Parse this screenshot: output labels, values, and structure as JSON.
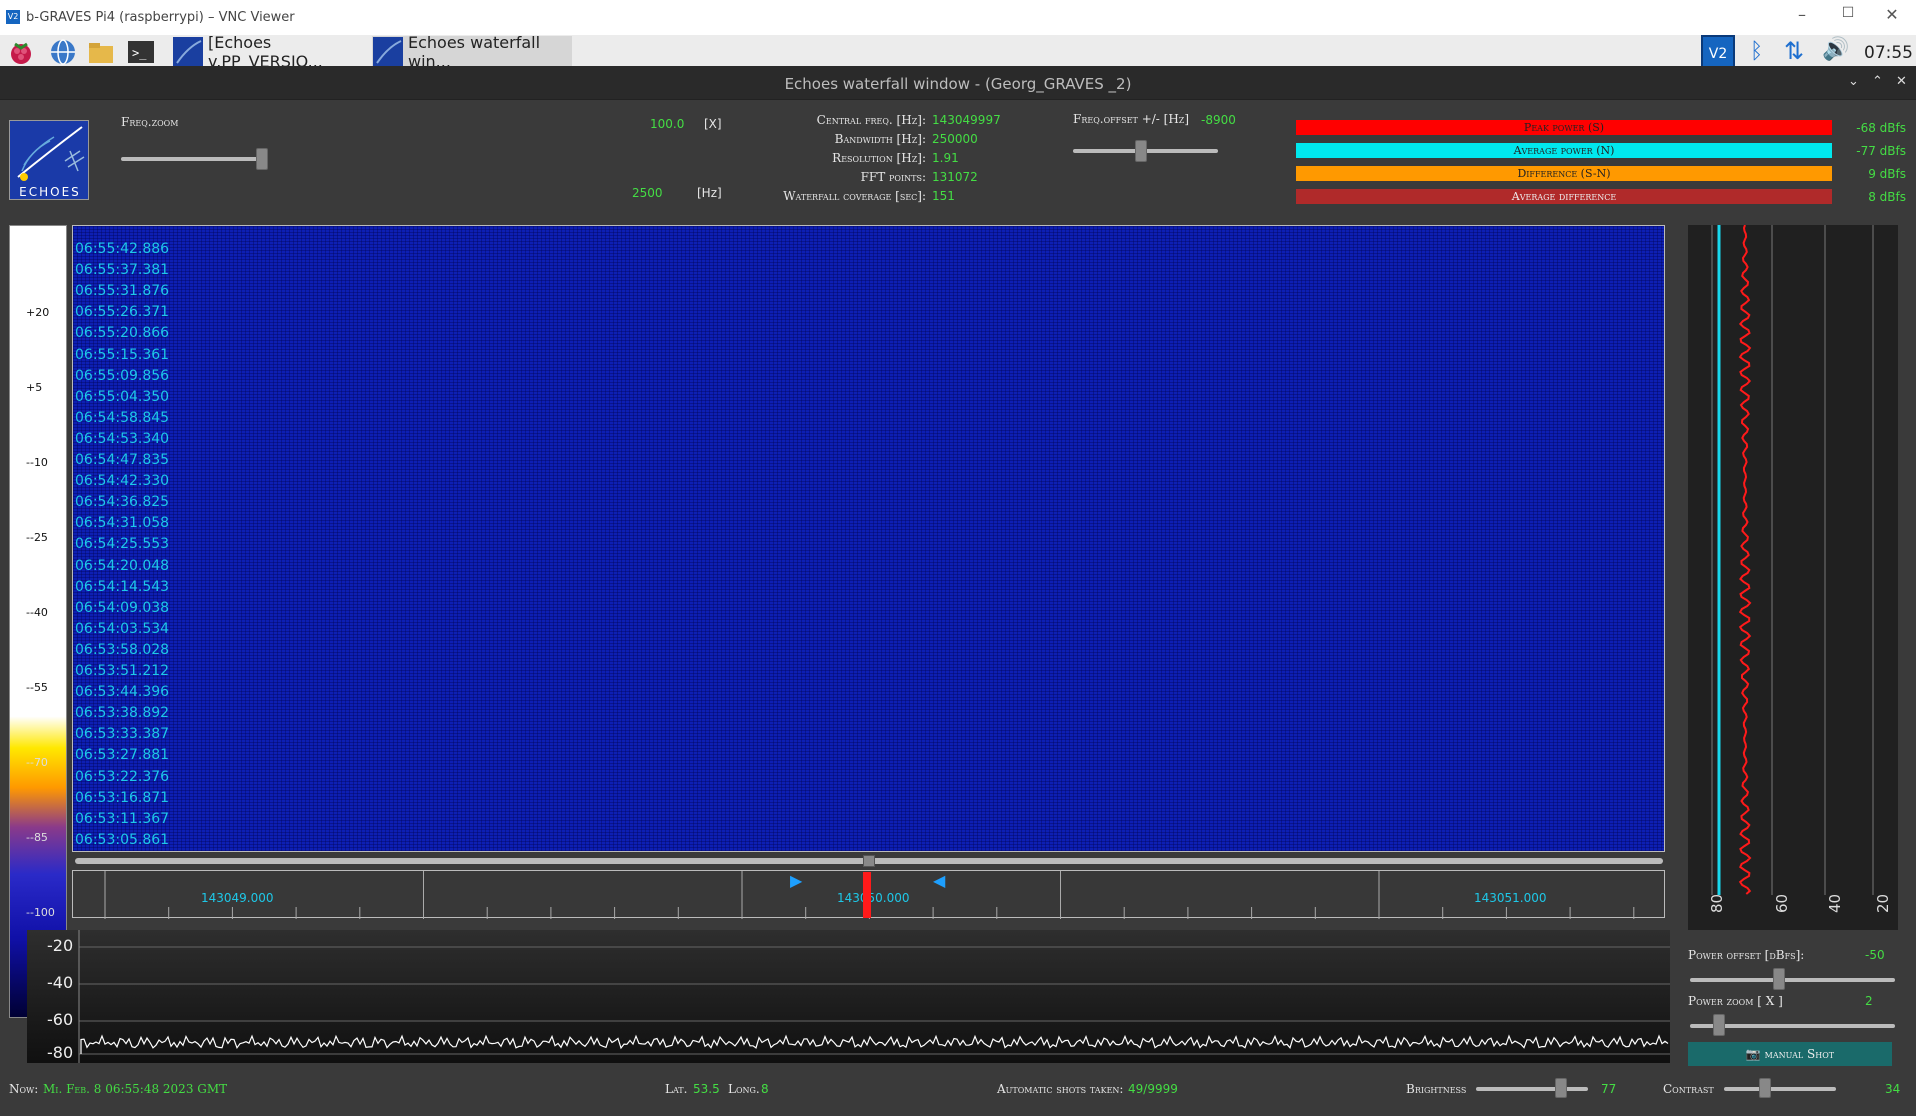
{
  "window": {
    "title": "b-GRAVES Pi4 (raspberrypi) – VNC Viewer",
    "app_icon": "V2"
  },
  "taskbar": {
    "items": [
      {
        "label": "[Echoes v.PP_VERSIO..."
      },
      {
        "label": "Echoes waterfall win..."
      }
    ],
    "tray_icon": "V2",
    "clock": "07:55"
  },
  "app": {
    "title": "Echoes waterfall window - (Georg_GRAVES _2)",
    "logo": {
      "text": "ECHOES"
    },
    "freq_zoom": {
      "label": "Freq.zoom",
      "value": "100.0",
      "unit": "[X]",
      "hz": "2500",
      "hz_unit": "[Hz]",
      "level": 0.98
    },
    "info": [
      {
        "label": "Central freq. [Hz]:",
        "value": "143049997"
      },
      {
        "label": "Bandwidth [Hz]:",
        "value": "250000"
      },
      {
        "label": "Resolution [Hz]:",
        "value": "1.91"
      },
      {
        "label": "FFT points:",
        "value": "131072"
      },
      {
        "label": "Waterfall coverage [sec]:",
        "value": "151"
      }
    ],
    "freq_offset": {
      "label": "Freq.offset +/- [Hz]",
      "value": "-8900",
      "level": 0.45
    },
    "power_bars": [
      {
        "label": "Peak power (S)",
        "value": "-68 dBfs",
        "color": "#ff0000"
      },
      {
        "label": "Average power (N)",
        "value": "-77 dBfs",
        "color": "#00e8ee"
      },
      {
        "label": "Difference (S-N)",
        "value": "9 dBfs",
        "color": "#ff9900"
      },
      {
        "label": "Average difference",
        "value": "8 dBfs",
        "color": "#b02a2a"
      }
    ],
    "color_scale": [
      "+20",
      "+5",
      "--10",
      "--25",
      "--40",
      "--55",
      "--70",
      "--85",
      "--100"
    ],
    "timestamps": [
      "06:55:42.886",
      "06:55:37.381",
      "06:55:31.876",
      "06:55:26.371",
      "06:55:20.866",
      "06:55:15.361",
      "06:55:09.856",
      "06:55:04.350",
      "06:54:58.845",
      "06:54:53.340",
      "06:54:47.835",
      "06:54:42.330",
      "06:54:36.825",
      "06:54:31.058",
      "06:54:25.553",
      "06:54:20.048",
      "06:54:14.543",
      "06:54:09.038",
      "06:54:03.534",
      "06:53:58.028",
      "06:53:51.212",
      "06:53:44.396",
      "06:53:38.892",
      "06:53:33.387",
      "06:53:27.881",
      "06:53:22.376",
      "06:53:16.871",
      "06:53:11.367",
      "06:53:05.861"
    ],
    "freq_ticks": [
      "143049.000",
      "143050.000",
      "143051.000"
    ],
    "side_axis": [
      "80",
      "60",
      "40",
      "20"
    ],
    "spectrum_axis": [
      "-20",
      "-40",
      "-60",
      "-80"
    ],
    "power_offset": {
      "label": "Power offset [dBfs]:",
      "value": "-50",
      "level": 0.43
    },
    "power_zoom": {
      "label": "Power zoom [ X ]",
      "value": "2",
      "level": 0.12
    },
    "manual_shot": "manual Shot",
    "status": {
      "now_label": "Now:",
      "now_value": "Mi. Feb. 8 06:55:48 2023 GMT",
      "lat_label": "Lat.",
      "lat_value": "53.5",
      "long_label": "Long.",
      "long_value": "8",
      "shots_label": "Automatic shots taken:",
      "shots_value": "49/9999",
      "brightness_label": "Brightness",
      "brightness_value": "77",
      "brightness_level": 0.77,
      "contrast_label": "Contrast",
      "contrast_value": "34",
      "contrast_level": 0.34
    }
  }
}
